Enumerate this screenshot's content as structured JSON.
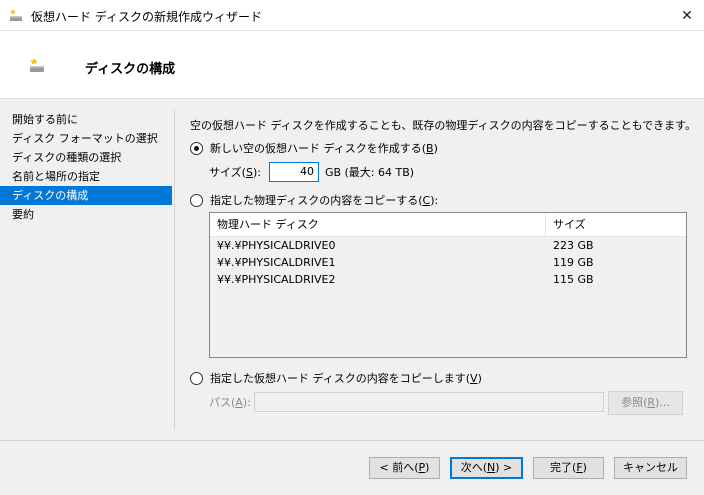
{
  "window": {
    "title": "仮想ハード ディスクの新規作成ウィザード",
    "close_glyph": "✕"
  },
  "header": {
    "title": "ディスクの構成"
  },
  "sidebar": {
    "items": [
      {
        "label": "開始する前に"
      },
      {
        "label": "ディスク フォーマットの選択"
      },
      {
        "label": "ディスクの種類の選択"
      },
      {
        "label": "名前と場所の指定"
      },
      {
        "label": "ディスクの構成",
        "active": true
      },
      {
        "label": "要約"
      }
    ]
  },
  "main": {
    "description": "空の仮想ハード ディスクを作成することも、既存の物理ディスクの内容をコピーすることもできます。",
    "option_new": {
      "label": "新しい空の仮想ハード ディスクを作成する(",
      "key": "B",
      "suffix": ")",
      "checked": true
    },
    "size": {
      "label": "サイズ(",
      "key": "S",
      "suffix": "):",
      "value": "40",
      "unit": "GB (最大: 64 TB)"
    },
    "option_copy_physical": {
      "label": "指定した物理ディスクの内容をコピーする(",
      "key": "C",
      "suffix": "):",
      "checked": false
    },
    "disk_table": {
      "columns": [
        "物理ハード ディスク",
        "サイズ"
      ],
      "rows": [
        {
          "name": "¥¥.¥PHYSICALDRIVE0",
          "size": "223 GB"
        },
        {
          "name": "¥¥.¥PHYSICALDRIVE1",
          "size": "119 GB"
        },
        {
          "name": "¥¥.¥PHYSICALDRIVE2",
          "size": "115 GB"
        }
      ]
    },
    "option_copy_virtual": {
      "label": "指定した仮想ハード ディスクの内容をコピーします(",
      "key": "V",
      "suffix": ")",
      "checked": false
    },
    "path": {
      "label": "パス(",
      "key": "A",
      "suffix": "):",
      "value": ""
    },
    "browse": {
      "label": "参照(",
      "key": "R",
      "suffix": ")..."
    }
  },
  "footer": {
    "prev": {
      "label": "< 前へ(",
      "key": "P",
      "suffix": ")"
    },
    "next": {
      "label": "次へ(",
      "key": "N",
      "suffix": ") >"
    },
    "finish": {
      "label": "完了(",
      "key": "F",
      "suffix": ")"
    },
    "cancel": {
      "label": "キャンセル"
    }
  },
  "colors": {
    "accent": "#0078d7",
    "background": "#f0f0f0"
  }
}
